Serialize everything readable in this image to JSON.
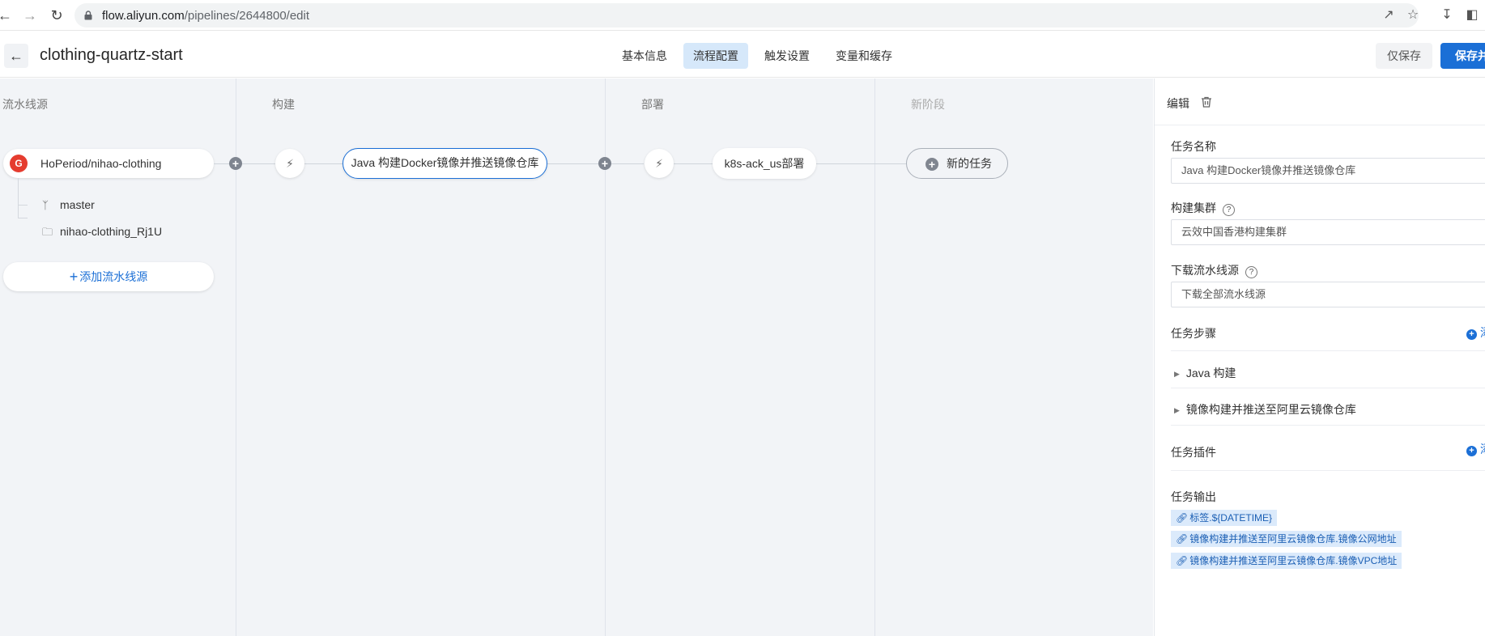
{
  "browser": {
    "url_host": "flow.aliyun.com",
    "url_path": "/pipelines/2644800/edit"
  },
  "header": {
    "title": "clothing-quartz-start",
    "tabs": [
      {
        "label": "基本信息",
        "active": false
      },
      {
        "label": "流程配置",
        "active": true
      },
      {
        "label": "触发设置",
        "active": false
      },
      {
        "label": "变量和缓存",
        "active": false
      }
    ],
    "save_label": "仅保存",
    "save_run_label": "保存并"
  },
  "canvas": {
    "stages": [
      "流水线源",
      "构建",
      "部署",
      "新阶段"
    ],
    "source": {
      "logo_letter": "G",
      "name": "HoPeriod/nihao-clothing",
      "branch": "master",
      "folder": "nihao-clothing_Rj1U"
    },
    "add_source_label": "添加流水线源",
    "build_job": "Java 构建Docker镜像并推送镜像仓库",
    "deploy_job": "k8s-ack_us部署",
    "new_task_label": "新的任务"
  },
  "panel": {
    "edit_label": "编辑",
    "task_name_label": "任务名称",
    "task_name_value": "Java 构建Docker镜像并推送镜像仓库",
    "cluster_label": "构建集群",
    "cluster_value": "云效中国香港构建集群",
    "download_label": "下载流水线源",
    "download_value": "下载全部流水线源",
    "steps_label": "任务步骤",
    "add_label": "添",
    "steps": [
      "Java 构建",
      "镜像构建并推送至阿里云镜像仓库"
    ],
    "plugins_label": "任务插件",
    "outputs_label": "任务输出",
    "outputs": [
      "标签.${DATETIME}",
      "镜像构建并推送至阿里云镜像仓库.镜像公网地址",
      "镜像构建并推送至阿里云镜像仓库.镜像VPC地址"
    ]
  },
  "colors": {
    "accent": "#1b6fd6",
    "canvas_bg": "#f2f4f7",
    "tab_active_bg": "#d6e8fa",
    "source_logo": "#e53c2f"
  }
}
